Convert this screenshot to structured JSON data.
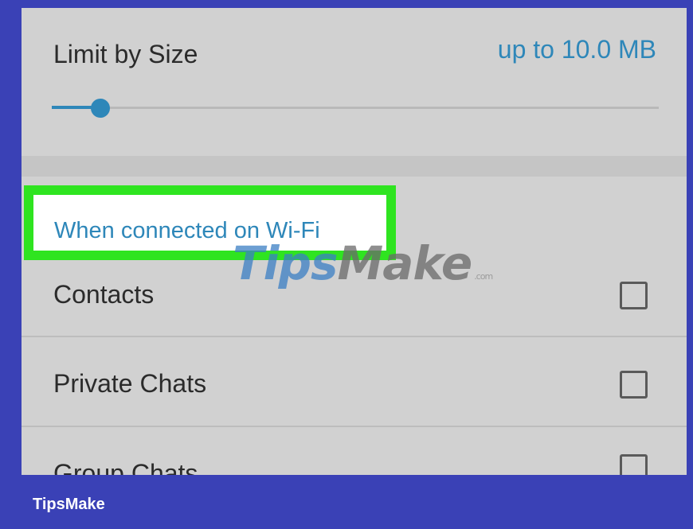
{
  "size_limit": {
    "label": "Limit by Size",
    "value": "up to 10.0 MB",
    "slider_fraction": 0.08
  },
  "section": {
    "header": "When connected on Wi-Fi",
    "items": [
      {
        "label": "Contacts",
        "checked": false
      },
      {
        "label": "Private Chats",
        "checked": false
      },
      {
        "label": "Group Chats",
        "checked": false
      }
    ]
  },
  "watermark": {
    "part1": "Tips",
    "part2": "Make",
    "suffix": ".com"
  },
  "footer": {
    "brand": "TipsMake"
  },
  "colors": {
    "accent": "#2e87b9",
    "highlight": "#2fe420",
    "frame": "#3a41b6",
    "background": "#d1d1d1"
  }
}
